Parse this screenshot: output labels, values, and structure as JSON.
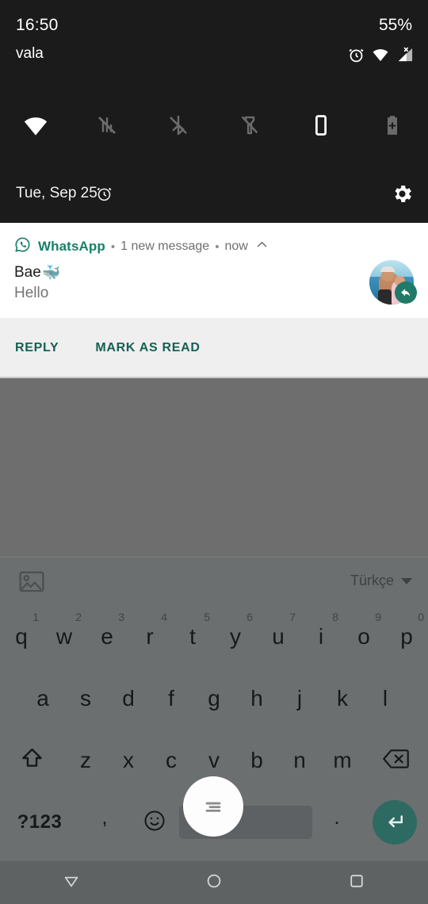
{
  "statusbar": {
    "time": "16:50",
    "battery": "55%",
    "carrier": "vala",
    "icons": [
      "alarm-icon",
      "wifi-icon",
      "signal-off-icon"
    ]
  },
  "quick_settings": {
    "tiles": [
      {
        "name": "wifi-tile",
        "icon": "wifi-icon",
        "enabled": true
      },
      {
        "name": "mobile-data-tile",
        "icon": "mobile-data-off-icon",
        "enabled": false
      },
      {
        "name": "bluetooth-tile",
        "icon": "bluetooth-off-icon",
        "enabled": false
      },
      {
        "name": "flashlight-tile",
        "icon": "flashlight-off-icon",
        "enabled": false
      },
      {
        "name": "auto-rotate-tile",
        "icon": "phone-rotate-icon",
        "enabled": true
      },
      {
        "name": "battery-saver-tile",
        "icon": "battery-saver-icon",
        "enabled": false
      }
    ]
  },
  "date_row": {
    "date": "Tue, Sep 25",
    "alarm_icon": "alarm-icon",
    "settings_icon": "gear-icon"
  },
  "notification": {
    "app_name": "WhatsApp",
    "separator": "•",
    "summary": "1 new message",
    "time": "now",
    "expand_icon": "chevron-up-icon",
    "sender": "Bae",
    "sender_emoji": "🐳",
    "message": "Hello",
    "avatar": "contact-avatar",
    "badge_icon": "whatsapp-reply-badge",
    "actions": [
      {
        "name": "reply-action",
        "label": "REPLY"
      },
      {
        "name": "mark-as-read-action",
        "label": "MARK AS READ"
      }
    ],
    "accent_color": "#17806a",
    "action_color": "#156055"
  },
  "keyboard": {
    "image_icon": "image-icon",
    "language": "Türkçe",
    "language_caret": "chevron-down-icon",
    "row1": [
      {
        "key": "q",
        "hint": "1"
      },
      {
        "key": "w",
        "hint": "2"
      },
      {
        "key": "e",
        "hint": "3"
      },
      {
        "key": "r",
        "hint": "4"
      },
      {
        "key": "t",
        "hint": "5"
      },
      {
        "key": "y",
        "hint": "6"
      },
      {
        "key": "u",
        "hint": "7"
      },
      {
        "key": "i",
        "hint": "8"
      },
      {
        "key": "o",
        "hint": "9"
      },
      {
        "key": "p",
        "hint": "0"
      }
    ],
    "row2": [
      "a",
      "s",
      "d",
      "f",
      "g",
      "h",
      "j",
      "k",
      "l"
    ],
    "row3": [
      "z",
      "x",
      "c",
      "v",
      "b",
      "n",
      "m"
    ],
    "shift_icon": "shift-icon",
    "backspace_icon": "backspace-icon",
    "symbols_key": "?123",
    "comma_key": ",",
    "emoji_icon": "emoji-icon",
    "period_key": ".",
    "enter_icon": "enter-icon",
    "enter_color": "#2d6a62"
  },
  "overlay": {
    "float_button_icon": "text-lines-icon"
  },
  "navbar": {
    "back_icon": "keyboard-hide-icon",
    "home_icon": "home-circle-icon",
    "recents_icon": "recents-square-icon"
  }
}
